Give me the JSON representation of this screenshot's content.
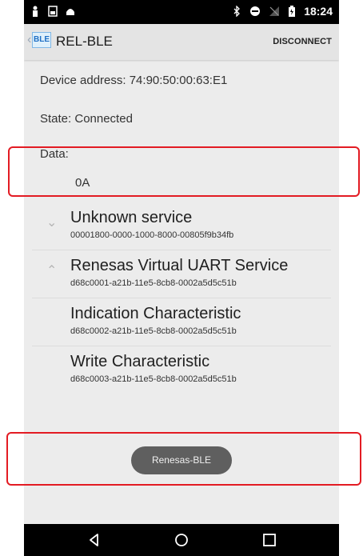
{
  "status_bar": {
    "time": "18:24",
    "left_icons": [
      "person-icon",
      "sd-card-icon",
      "android-icon"
    ],
    "right_icons": [
      "bluetooth-icon",
      "do-not-disturb-icon",
      "no-signal-icon",
      "battery-icon"
    ]
  },
  "action_bar": {
    "logo_text": "BLE",
    "title": "REL-BLE",
    "disconnect_label": "DISCONNECT"
  },
  "device": {
    "address_label": "Device address: 74:90:50:00:63:E1",
    "state_label": "State: Connected",
    "data_label": "Data:",
    "data_value": "0A"
  },
  "services": [
    {
      "name": "Unknown service",
      "uuid": "00001800-0000-1000-8000-00805f9b34fb",
      "expanded": false
    },
    {
      "name": "Renesas Virtual UART Service",
      "uuid": "d68c0001-a21b-11e5-8cb8-0002a5d5c51b",
      "expanded": true,
      "characteristics": [
        {
          "name": "Indication Characteristic",
          "uuid": "d68c0002-a21b-11e5-8cb8-0002a5d5c51b"
        },
        {
          "name": "Write Characteristic",
          "uuid": "d68c0003-a21b-11e5-8cb8-0002a5d5c51b"
        }
      ]
    }
  ],
  "toast": {
    "text": "Renesas-BLE"
  },
  "nav_bar": {
    "buttons": [
      "back-icon",
      "home-icon",
      "recents-icon"
    ]
  },
  "colors": {
    "highlight": "#e31b23",
    "toast_bg": "#5f5f5f"
  }
}
